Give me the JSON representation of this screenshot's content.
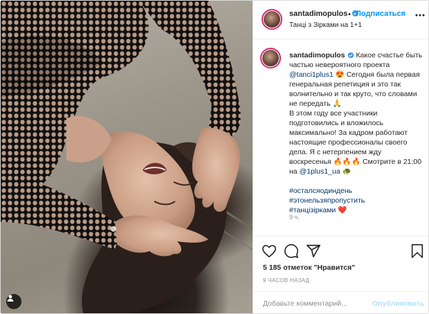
{
  "colors": {
    "accent": "#0095f6",
    "link": "#00376b",
    "muted": "#8e8e8e",
    "publish_disabled": "#b2dffc",
    "heart": "#ed4956"
  },
  "photo": {
    "alt": "",
    "corner_icon": "user-tag-icon"
  },
  "header": {
    "username": "santadimopulos",
    "verified_icon": "verified-badge-icon",
    "separator": "•",
    "follow_label": "Подписаться",
    "subtitle": "Танці з Зірками на 1+1",
    "more_icon": "more-options-icon"
  },
  "caption": {
    "username": "santadimopulos",
    "line1": " Какое счастье быть частью невероятного проекта ",
    "mention1": "@tanci1plus1",
    "emoji1": "😍",
    "line2": " Сегодня была первая генеральная репетиция и это так волнительно и так круто, что словами не передать ",
    "emoji2": "🙏",
    "line3": "В этом году все участники подготовились и вложилось максимально! За кадром работают настоящие профессионалы своего дела. Я с нетерпением жду воскресенья ",
    "emoji3": "🔥🔥🔥",
    "line4": " Смотрите в 21:00 на ",
    "mention2": "@1plus1_ua",
    "emoji4": "🐢",
    "tags": [
      "#осталсяодиндень",
      "#этонельзяпропустить",
      "#танцізірками"
    ],
    "tag_emoji": "❤️",
    "time": "9 ч."
  },
  "actions": {
    "like_icon": "heart-icon",
    "comment_icon": "comment-icon",
    "share_icon": "share-icon",
    "save_icon": "bookmark-icon"
  },
  "likes_text": "5 185 отметок \"Нравится\"",
  "time_ago": "9 ЧАСОВ НАЗАД",
  "comment": {
    "placeholder": "Добавьте комментарий...",
    "value": "",
    "publish_label": "Опубликовать"
  }
}
